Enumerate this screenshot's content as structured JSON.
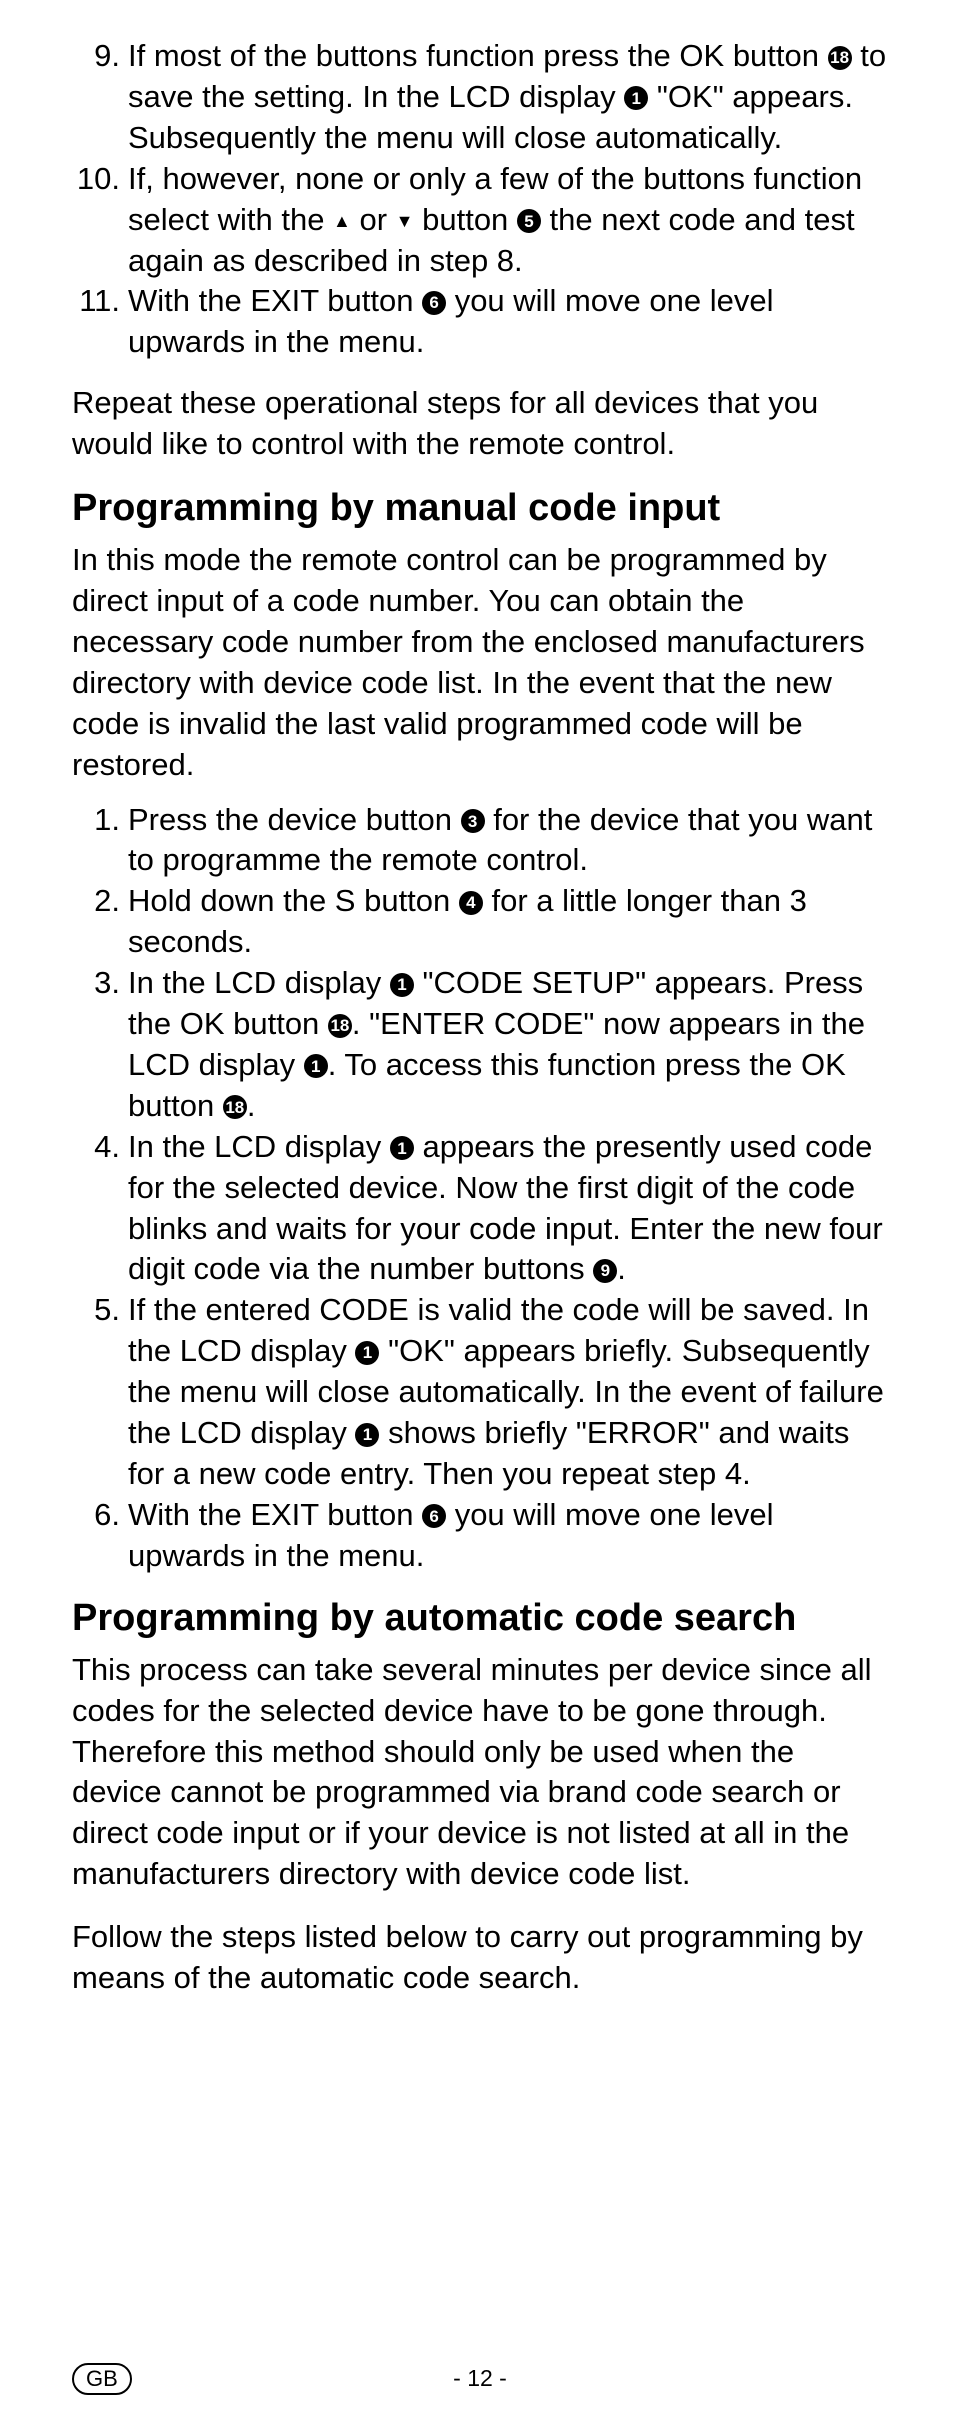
{
  "top_list": [
    {
      "n": "9.",
      "pre": "If most of the buttons function press the OK button ",
      "c1": "18",
      "mid": " to save the setting. In the LCD display ",
      "c2": "1",
      "post": " \"OK\" appears. Subsequently the menu will close automatically."
    },
    {
      "n": "10.",
      "full1": "If, however, none or only a few of the buttons function select with the ",
      "arrowup": "▲",
      "mid1": " or ",
      "arrowdn": "▼",
      "mid2": " button ",
      "c1": "5",
      "post": " the next code and test again as described in step 8."
    },
    {
      "n": "11.",
      "pre": "With the EXIT button ",
      "c1": "6",
      "post": " you will move one level upwards in the menu."
    }
  ],
  "repeat_para": "Repeat these operational steps for all devices that you would like to control with the remote control.",
  "heading1": "Programming by manual code input",
  "intro1": "In this mode the remote control can be programmed by direct input of a code number. You can obtain the necessary code number from the enclosed manufacturers directory with device code list. In the event that the new code is invalid the last valid programmed code will be restored.",
  "mid_list": [
    {
      "n": "1.",
      "pre": "Press the device button ",
      "c1": "3",
      "post": " for the device that you want to programme the remote control."
    },
    {
      "n": "2.",
      "pre": "Hold down the S button ",
      "c1": "4",
      "post": " for a little longer than 3 seconds."
    },
    {
      "n": "3.",
      "pre": "In the LCD display ",
      "c1": "1",
      "mid1": " \"CODE SETUP\" appears. Press the OK button ",
      "c2": "18",
      "mid2": ". \"ENTER CODE\" now appears in the LCD display ",
      "c3": "1",
      "mid3": ". To access this function press the OK button ",
      "c4": "18",
      "post": "."
    },
    {
      "n": "4.",
      "pre": "In the LCD display ",
      "c1": "1",
      "mid1": " appears the presently used code for the selected device. Now the first digit of the code blinks and waits for your code input. Enter the new four digit code via the number buttons ",
      "c2": "9",
      "post": "."
    },
    {
      "n": "5.",
      "pre": "If the entered CODE is valid the code will be saved. In the LCD display ",
      "c1": "1",
      "mid1": " \"OK\" appears briefly. Subsequently the menu will close automatically. In the event of failure the LCD display ",
      "c2": "1",
      "post": " shows briefly \"ERROR\" and waits for a new code entry. Then you repeat step 4."
    },
    {
      "n": "6.",
      "pre": "With the EXIT button ",
      "c1": "6",
      "post": " you will move one level upwards in the menu."
    }
  ],
  "heading2": "Programming by automatic code search",
  "intro2": "This process can take several minutes per device since all codes for the selected device have to be gone through. Therefore this method should only be used when the device cannot be programmed via brand code search or direct code input or if your device is not listed at all in the manufacturers directory with device code list.",
  "follow": "Follow the steps listed below to carry out programming by means of the automatic code search.",
  "footer": {
    "region": "GB",
    "page": "- 12 -"
  }
}
